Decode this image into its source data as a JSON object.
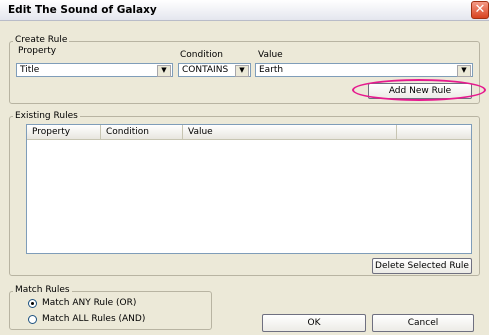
{
  "window": {
    "title": "Edit The Sound of Galaxy",
    "close_glyph": "✕"
  },
  "create_rule": {
    "legend": "Create Rule",
    "property_label": "Property",
    "condition_label": "Condition",
    "value_label": "Value",
    "property_value": "Title",
    "condition_value": "CONTAINS",
    "value_value": "Earth",
    "dropdown_glyph": "▼",
    "add_button": "Add New Rule"
  },
  "existing_rules": {
    "legend": "Existing Rules",
    "columns": [
      "Property",
      "Condition",
      "Value"
    ],
    "rows": [],
    "delete_button": "Delete Selected Rule"
  },
  "match_rules": {
    "legend": "Match Rules",
    "options": [
      {
        "label": "Match ANY Rule (OR)",
        "checked": true
      },
      {
        "label": "Match ALL Rules (AND)",
        "checked": false
      }
    ]
  },
  "footer": {
    "ok": "OK",
    "cancel": "Cancel"
  },
  "colors": {
    "highlight": "#e6198e",
    "dialog_bg": "#ece9d8",
    "close_button": "#d8431f"
  }
}
